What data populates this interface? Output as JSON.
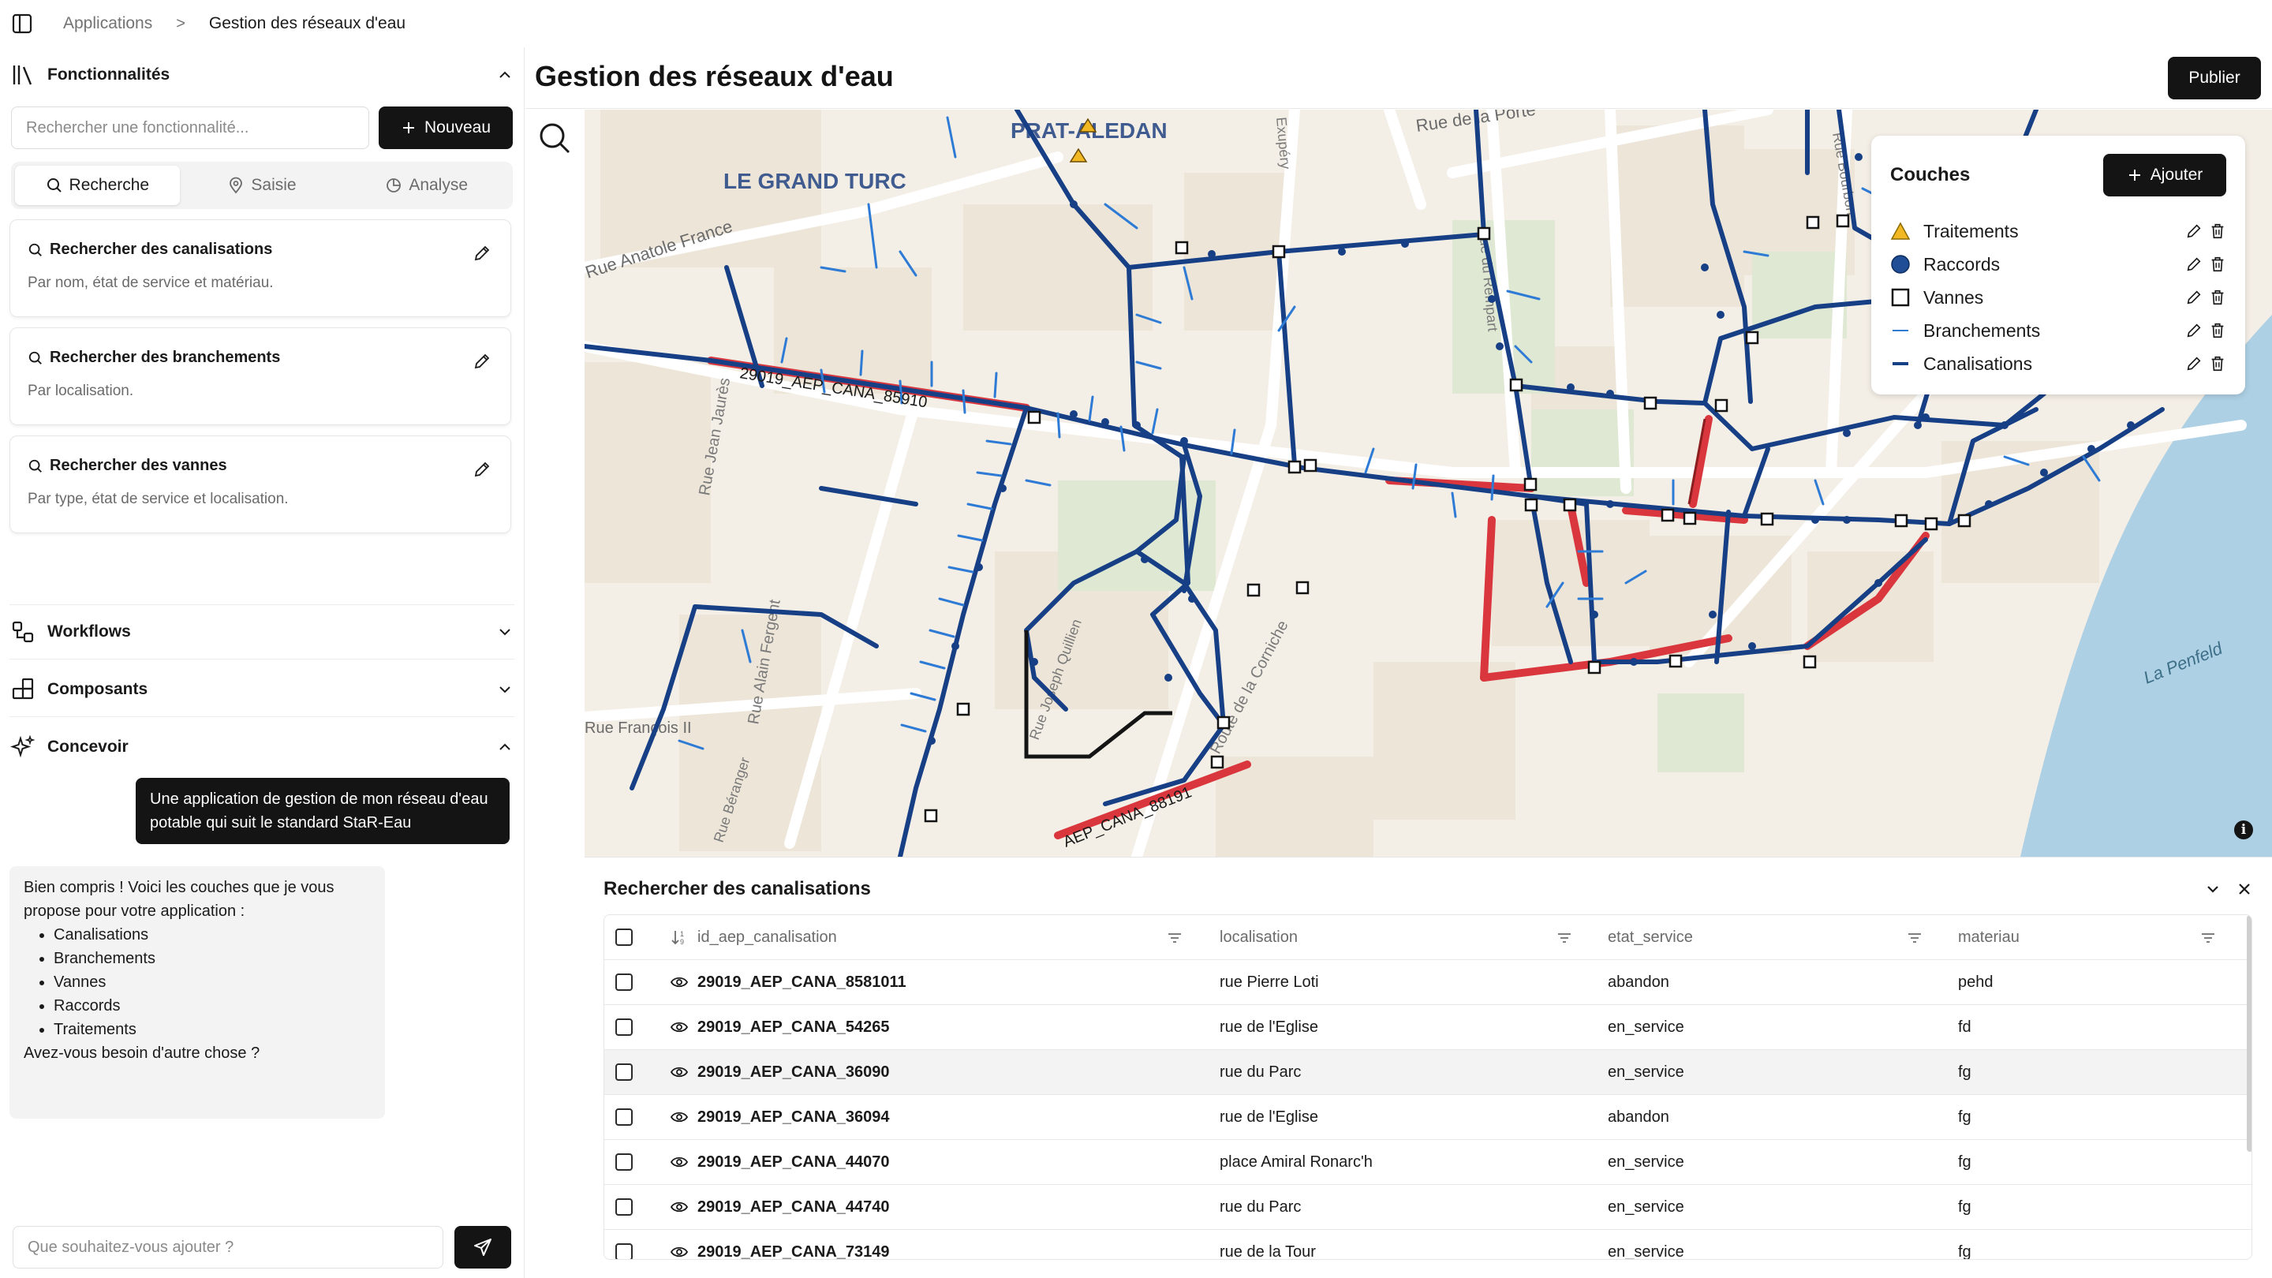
{
  "breadcrumb": {
    "root": "Applications",
    "separator": ">",
    "current": "Gestion des réseaux d'eau"
  },
  "features": {
    "title": "Fonctionnalités",
    "search_placeholder": "Rechercher une fonctionnalité...",
    "new_label": "Nouveau",
    "tabs": [
      {
        "label": "Recherche",
        "icon": "search-icon"
      },
      {
        "label": "Saisie",
        "icon": "map-pin-icon"
      },
      {
        "label": "Analyse",
        "icon": "pie-chart-icon"
      }
    ],
    "cards": [
      {
        "title": "Rechercher des canalisations",
        "desc": "Par nom, état de service et matériau."
      },
      {
        "title": "Rechercher des branchements",
        "desc": "Par localisation."
      },
      {
        "title": "Rechercher des vannes",
        "desc": "Par type, état de service et localisation."
      }
    ]
  },
  "sections": {
    "workflows": "Workflows",
    "components": "Composants",
    "design": "Concevoir"
  },
  "chat": {
    "user_message": "Une application de gestion de mon réseau d'eau potable qui suit le standard StaR-Eau",
    "bot_intro": "Bien compris ! Voici les couches que je vous propose pour votre application :",
    "bot_items": [
      "Canalisations",
      "Branchements",
      "Vannes",
      "Raccords",
      "Traitements"
    ],
    "bot_outro": "Avez-vous besoin d'autre chose ?",
    "input_placeholder": "Que souhaitez-vous ajouter ?"
  },
  "main": {
    "title": "Gestion des réseaux d'eau",
    "publish_label": "Publier"
  },
  "map": {
    "labels": [
      "PRAT-ALEDAN",
      "LE GRAND TURC",
      "Rue Anatole France",
      "Rue de la Porte",
      "Rue Jean Jaurès",
      "Rue Alain Fergent",
      "Rue François II",
      "Route de la Corniche",
      "La Penfeld",
      "Rue Joseph Quillien",
      "Rue Béranger",
      "Exupéry",
      "Rue du Rempart",
      "Rue Bourbon",
      "29019_AEP_CANA_85910",
      "AEP_CANA_88191"
    ],
    "info_label": "i"
  },
  "layers": {
    "title": "Couches",
    "add_label": "Ajouter",
    "items": [
      {
        "name": "Traitements",
        "symbol": "triangle",
        "color": "#f2b824"
      },
      {
        "name": "Raccords",
        "symbol": "circle",
        "color": "#1f4e96"
      },
      {
        "name": "Vannes",
        "symbol": "square",
        "color": "#141414"
      },
      {
        "name": "Branchements",
        "symbol": "thin-line",
        "color": "#2e7bd6"
      },
      {
        "name": "Canalisations",
        "symbol": "thick-line",
        "color": "#163f85"
      }
    ]
  },
  "results": {
    "title": "Rechercher des canalisations",
    "columns": [
      "id_aep_canalisation",
      "localisation",
      "etat_service",
      "materiau"
    ],
    "rows": [
      {
        "id": "29019_AEP_CANA_8581011",
        "loc": "rue Pierre Loti",
        "etat": "abandon",
        "mat": "pehd"
      },
      {
        "id": "29019_AEP_CANA_54265",
        "loc": "rue de l'Eglise",
        "etat": "en_service",
        "mat": "fd"
      },
      {
        "id": "29019_AEP_CANA_36090",
        "loc": "rue du Parc",
        "etat": "en_service",
        "mat": "fg"
      },
      {
        "id": "29019_AEP_CANA_36094",
        "loc": "rue de l'Eglise",
        "etat": "abandon",
        "mat": "fg"
      },
      {
        "id": "29019_AEP_CANA_44070",
        "loc": "place Amiral Ronarc'h",
        "etat": "en_service",
        "mat": "fg"
      },
      {
        "id": "29019_AEP_CANA_44740",
        "loc": "rue du Parc",
        "etat": "en_service",
        "mat": "fg"
      },
      {
        "id": "29019_AEP_CANA_73149",
        "loc": "rue de la Tour",
        "etat": "en_service",
        "mat": "fg"
      }
    ],
    "highlighted_row": 2
  },
  "colors": {
    "accent": "#141414",
    "pipe": "#163f85",
    "pipe_highlight": "#d9363e",
    "branch": "#2e7bd6",
    "map_bg": "#f4efe6"
  }
}
